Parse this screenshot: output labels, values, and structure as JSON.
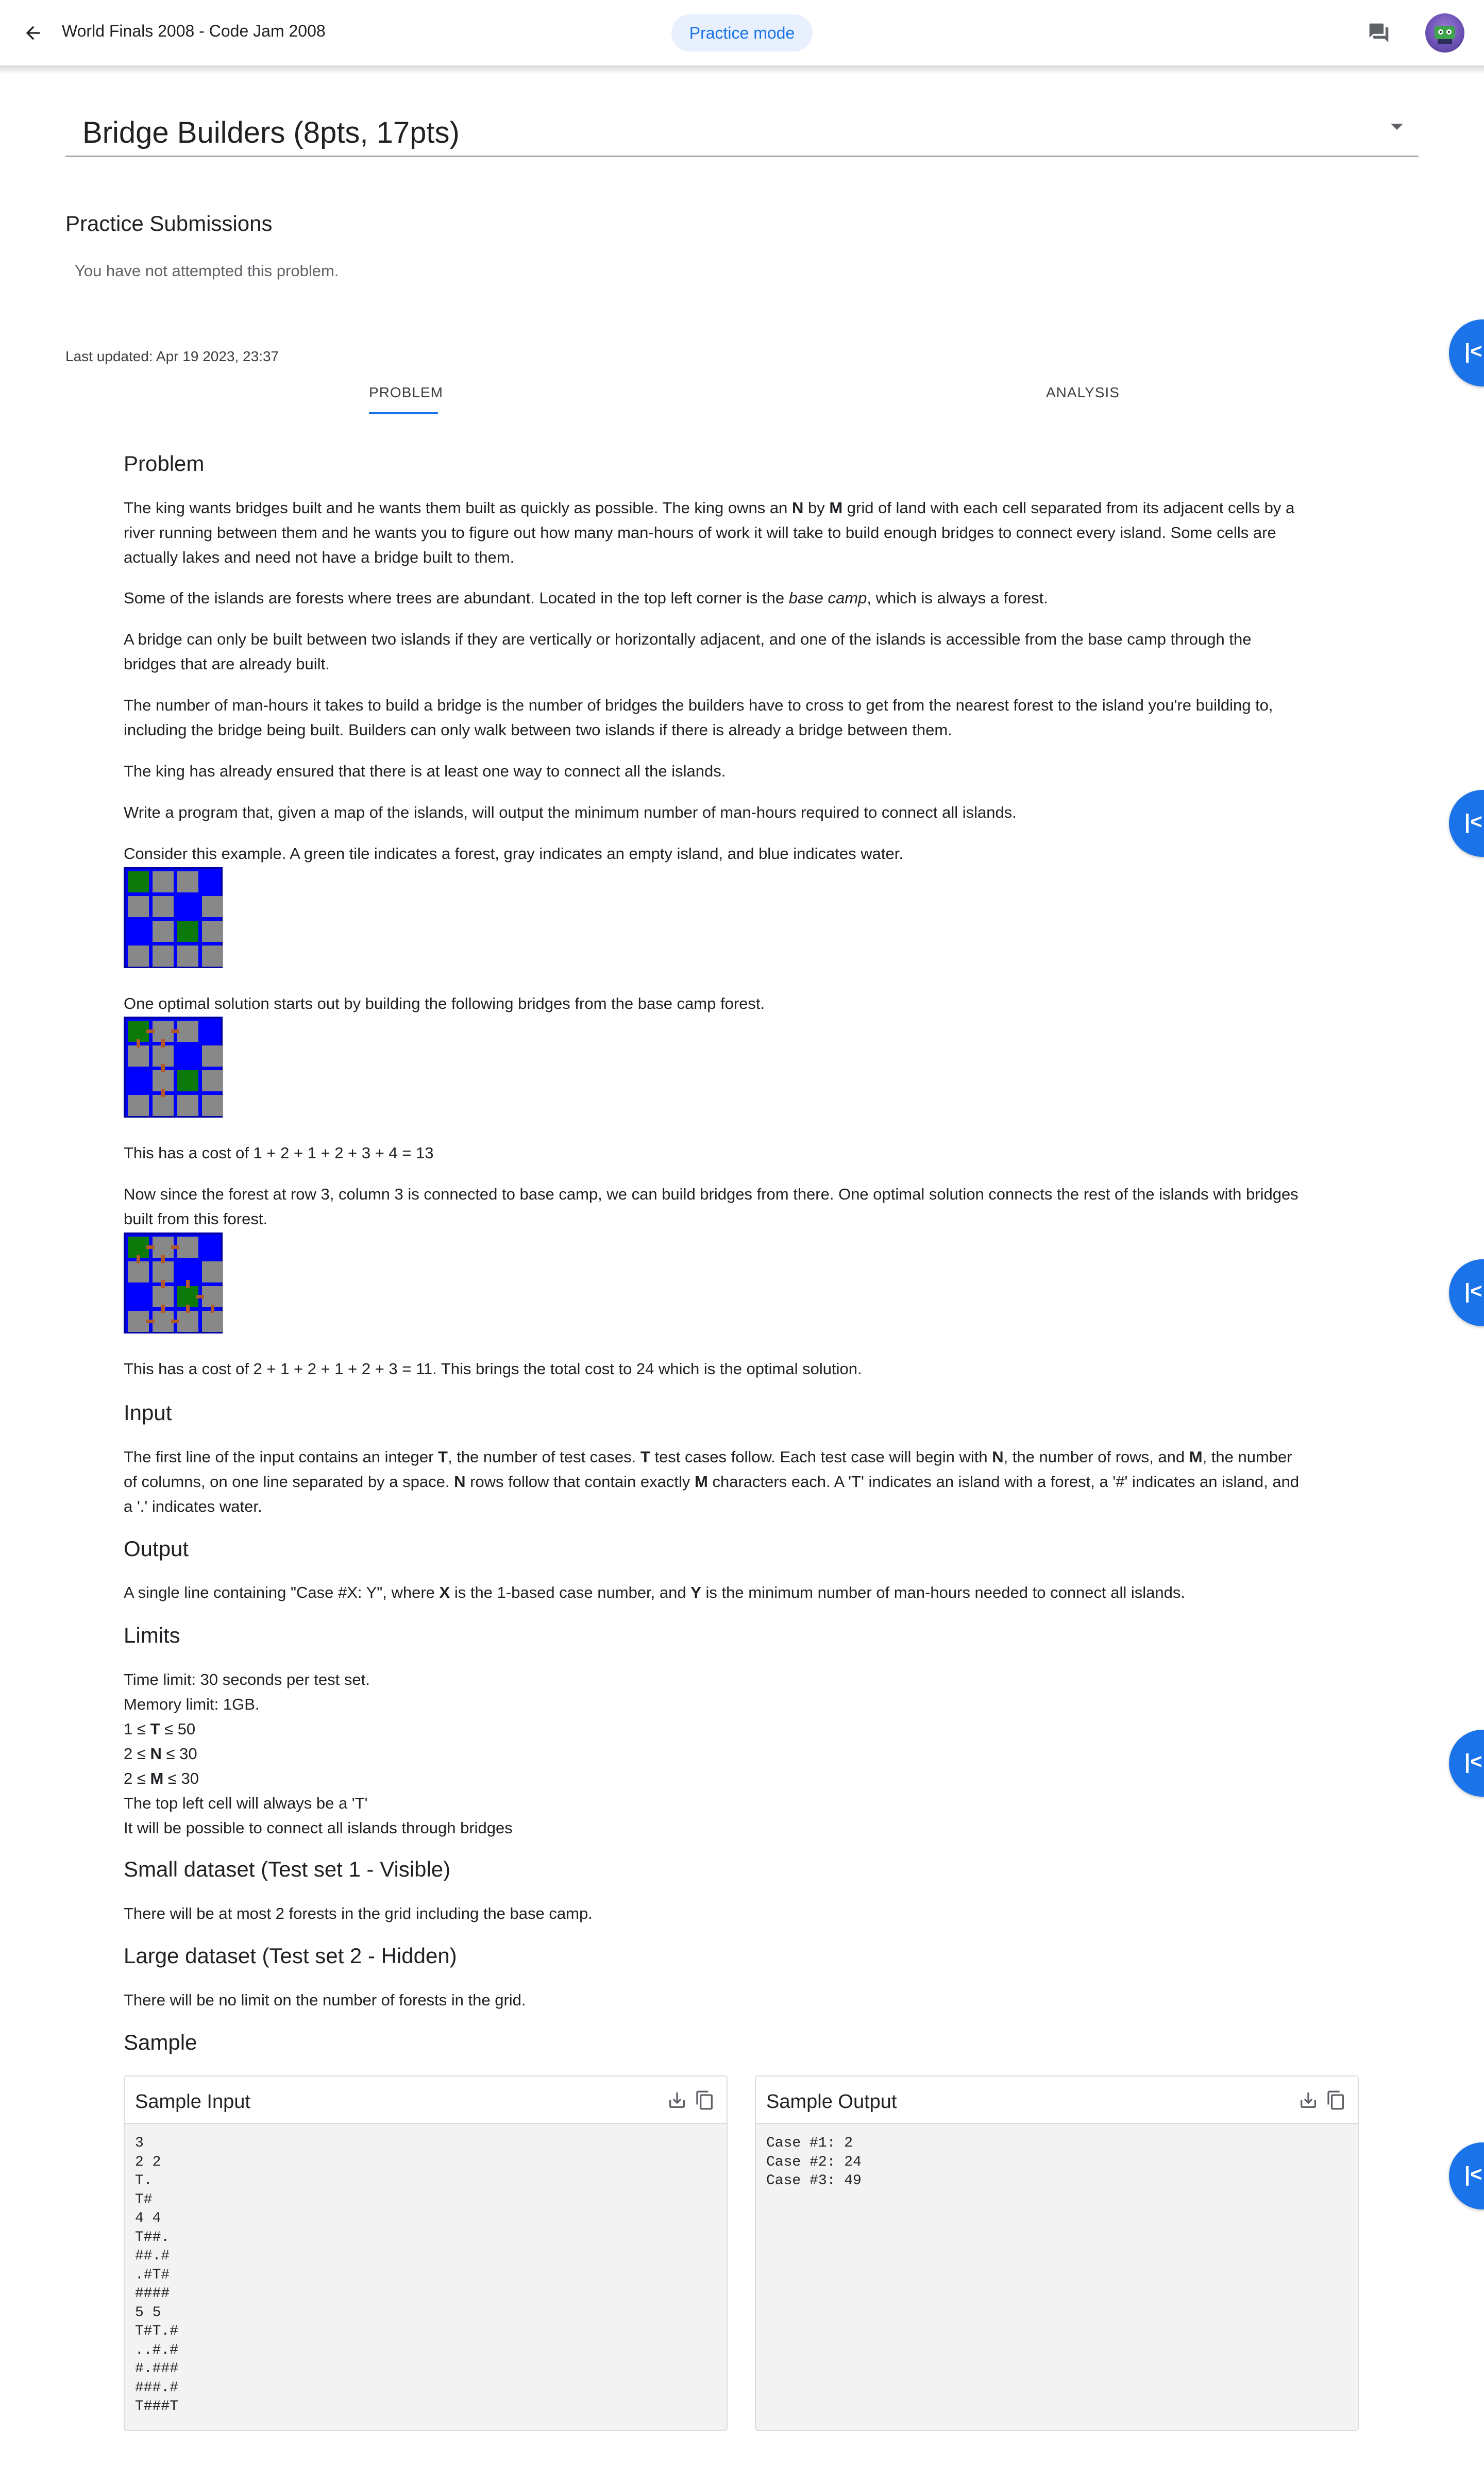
{
  "header": {
    "title": "World Finals 2008 - Code Jam 2008",
    "mode_chip": "Practice mode"
  },
  "problem_select": {
    "label": "Bridge Builders (8pts, 17pts)"
  },
  "submissions": {
    "title": "Practice Submissions",
    "status": "You have not attempted this problem."
  },
  "last_updated": "Last updated: Apr 19 2023, 23:37",
  "tabs": [
    {
      "label": "PROBLEM",
      "selected": true
    },
    {
      "label": "ANALYSIS",
      "selected": false
    }
  ],
  "statement": {
    "heading": "Problem",
    "p1": [
      "The king wants bridges built and he wants them built as quickly as possible. The king owns an ",
      "N",
      " by ",
      "M",
      " grid of land with each cell separated from its adjacent cells by a",
      "river running between them and he wants you to figure out how many man-hours of work it will take to build enough bridges to connect every island. Some cells are",
      "actually lakes and need not have a bridge built to them."
    ],
    "p2": [
      "Some of the islands are forests where trees are abundant. Located in the top left corner is the ",
      "base camp",
      ", which is always a forest."
    ],
    "p3": [
      "A bridge can only be built between two islands if they are vertically or horizontally adjacent, and one of the islands is accessible from the base camp through the",
      "bridges that are already built."
    ],
    "p4": [
      "The number of man-hours it takes to build a bridge is the number of bridges the builders have to cross to get from the nearest forest to the island you're building to,",
      "including the bridge being built. Builders can only walk between two islands if there is already a bridge between them."
    ],
    "p5": "The king has already ensured that there is at least one way to connect all the islands.",
    "p6": "Write a program that, given a map of the islands, will output the minimum number of man-hours required to connect all islands.",
    "p7": "Consider this example. A green tile indicates a forest, gray indicates an empty island, and blue indicates water.",
    "p8": "One optimal solution starts out by building the following bridges from the base camp forest.",
    "p9": "This has a cost of 1 + 2 + 1 + 2 + 3 + 4 = 13",
    "p10": [
      "Now since the forest at row 3, column 3 is connected to base camp, we can build bridges from there. One optimal solution connects the rest of the islands with bridges",
      "built from this forest."
    ],
    "p11": "This has a cost of 2 + 1 + 2 + 1 + 2 + 3 = 11. This brings the total cost to 24 which is the optimal solution."
  },
  "input": {
    "heading": "Input",
    "lines": [
      [
        "The first line of the input contains an integer ",
        "T",
        ", the number of test cases. ",
        "T",
        " test cases follow. Each test case will begin with ",
        "N",
        ", the number of rows, and ",
        "M",
        ", the number"
      ],
      [
        "of columns, on one line separated by a space. ",
        "N",
        " rows follow that contain exactly ",
        "M",
        " characters each. A 'T' indicates an island with a forest, a '#' indicates an island, and"
      ],
      [
        "a '.' indicates water."
      ]
    ]
  },
  "output": {
    "heading": "Output",
    "line": [
      "A single line containing \"Case #X: Y\", where ",
      "X",
      " is the 1-based case number, and ",
      "Y",
      " is the minimum number of man-hours needed to connect all islands."
    ]
  },
  "limits": {
    "heading": "Limits",
    "time": "Time limit: 30 seconds per test set.",
    "memory": "Memory limit: 1GB.",
    "c1": [
      "1 ≤ ",
      "T",
      " ≤ 50"
    ],
    "c2": [
      "2 ≤ ",
      "N",
      " ≤ 30"
    ],
    "c3": [
      "2 ≤ ",
      "M",
      " ≤ 30"
    ],
    "c4": "The top left cell will always be a 'T'",
    "c5": "It will be possible to connect all islands through bridges"
  },
  "small": {
    "heading": "Small dataset (Test set 1 - Visible)",
    "text": "There will be at most 2 forests in the grid including the base camp."
  },
  "large": {
    "heading": "Large dataset (Test set 2 - Hidden)",
    "text": "There will be no limit on the number of forests in the grid."
  },
  "sample": {
    "heading": "Sample",
    "input_title": "Sample Input",
    "output_title": "Sample Output",
    "input_text": "3\n2 2\nT.\nT#\n4 4\nT##.\n##.#\n.#T#\n####\n5 5\nT#T.#\n..#.#\n#.###\n###.#\nT###T",
    "output_text": "Case #1: 2\nCase #2: 24\nCase #3: 49",
    "icons": [
      "download-icon",
      "copy-icon"
    ]
  },
  "example_grid": [
    "T##.",
    "##.#",
    ".#T#",
    "####"
  ],
  "colors": {
    "accent": "#1a73e8",
    "forest": "#0b7a0b",
    "island": "#888888",
    "water": "#0000ff",
    "bridge": "#b05a2a"
  }
}
